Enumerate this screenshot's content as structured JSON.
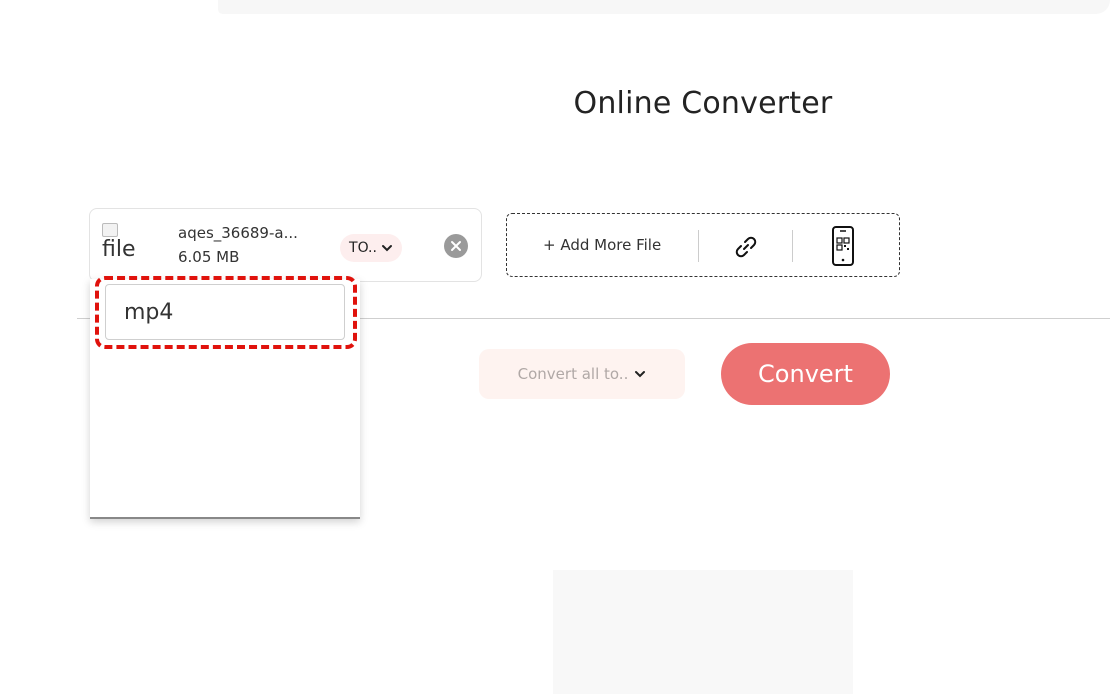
{
  "page": {
    "title": "Online Converter"
  },
  "file": {
    "thumb_alt": "file",
    "name": "aqes_36689-a...",
    "size": "6.05 MB",
    "format_button": "TO.."
  },
  "upload": {
    "add_more_label": "+ Add More File",
    "icons": [
      "link-icon",
      "qr-phone-icon"
    ]
  },
  "dropdown": {
    "search_value": "mp4"
  },
  "actions": {
    "convert_all_label": "Convert all to..",
    "convert_label": "Convert"
  },
  "colors": {
    "accent": "#ec7272",
    "highlight": "#e0120c",
    "soft_pink": "#fdeeee"
  }
}
